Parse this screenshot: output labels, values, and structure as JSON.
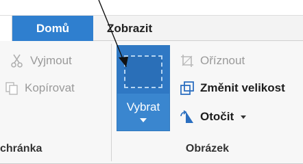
{
  "tabs": {
    "home": "Domů",
    "view": "Zobrazit"
  },
  "clipboard": {
    "cut": "Vyjmout",
    "copy": "Kopírovat",
    "group_label": "chránka"
  },
  "image": {
    "select": "Vybrat",
    "crop": "Oříznout",
    "resize": "Změnit velikost",
    "rotate": "Otočit",
    "group_label": "Obrázek"
  },
  "colors": {
    "accent": "#2f7fcf",
    "select_bg": "#3a86cf",
    "muted_text": "#9a9a9a"
  }
}
